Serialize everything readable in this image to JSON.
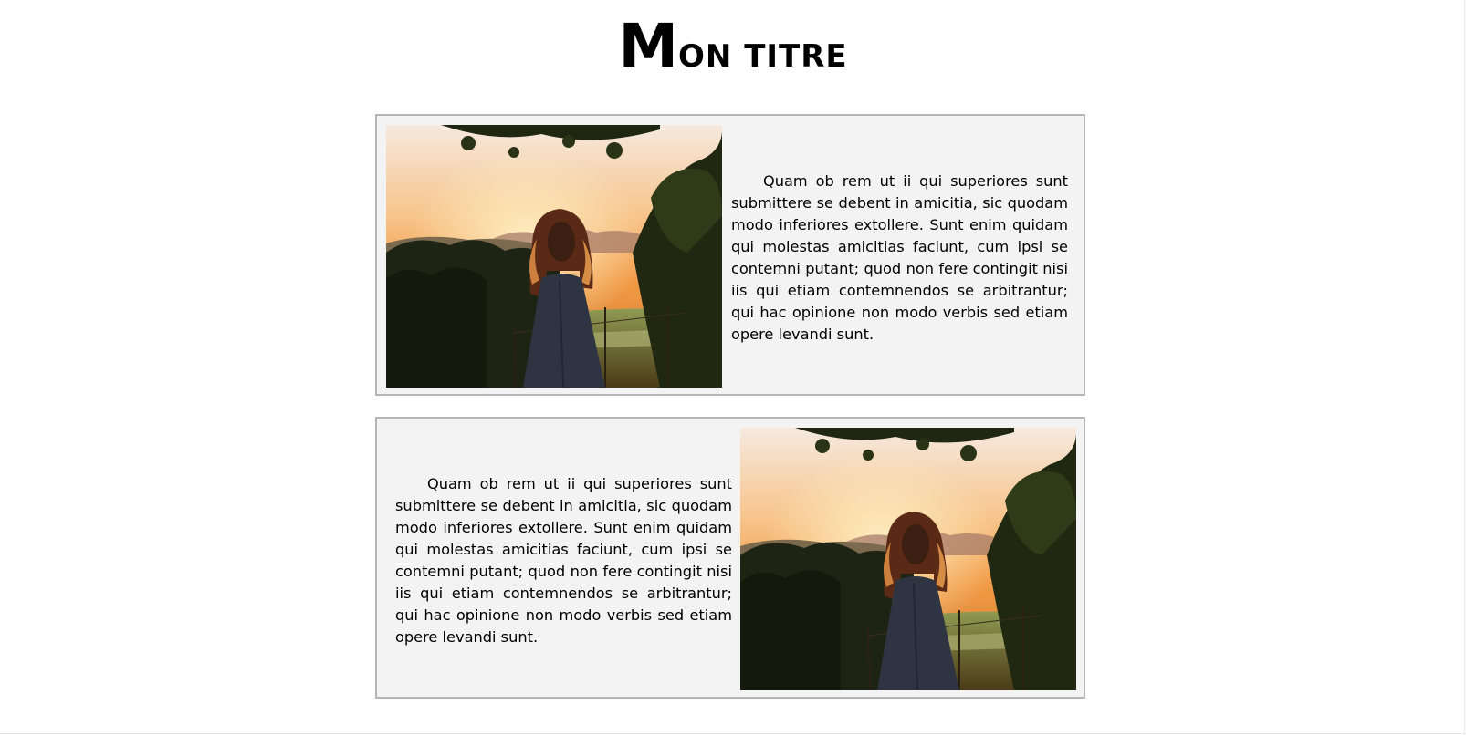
{
  "header": {
    "title_first": "M",
    "title_rest": "ON TITRE"
  },
  "sections": [
    {
      "text": "Quam ob rem ut ii qui superiores sunt submittere se debent in amicitia, sic quodam modo inferiores extollere. Sunt enim quidam qui molestas amicitias faciunt, cum ipsi se contemni putant; quod non fere contingit nisi iis qui etiam contemnendos se arbitrantur; qui hac opinione non modo verbis sed etiam opere levandi sunt.",
      "image_position": "left"
    },
    {
      "text": "Quam ob rem ut ii qui superiores sunt submittere se debent in amicitia, sic quodam modo inferiores extollere. Sunt enim quidam qui molestas amicitias faciunt, cum ipsi se contemni putant; quod non fere contingit nisi iis qui etiam contemnendos se arbitrantur; qui hac opinione non modo verbis sed etiam opere levandi sunt.",
      "image_position": "right"
    }
  ],
  "colors": {
    "card_background": "#f3f3f3",
    "card_border": "#b5b5b5"
  }
}
